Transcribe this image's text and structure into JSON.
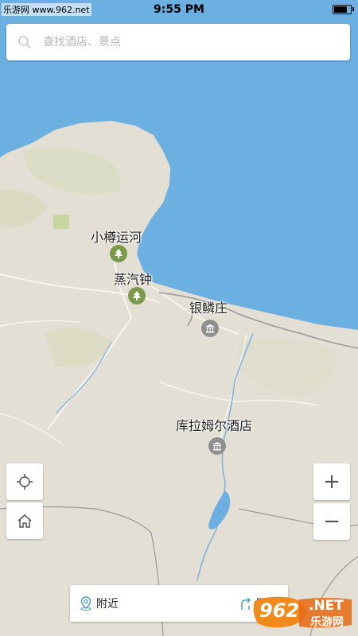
{
  "status_bar": {
    "time": "9:55 PM",
    "site_watermark": "乐游网 www.962.net",
    "battery_level": 0.85
  },
  "search": {
    "placeholder": "查找酒店、景点",
    "value": ""
  },
  "map": {
    "colors": {
      "water": "#6cb0e2",
      "land": "#e4dfd4",
      "green": "#cdd8ad",
      "poi_park": "#7a9a4a",
      "poi_museum": "#8f8f8f"
    },
    "places": [
      {
        "name": "小樽运河",
        "icon": "tree-icon"
      },
      {
        "name": "蒸汽钟",
        "icon": "tree-icon"
      },
      {
        "name": "银鳞庄",
        "icon": "museum-icon"
      },
      {
        "name": "库拉姆尔酒店",
        "icon": "museum-icon"
      }
    ]
  },
  "controls": {
    "locate": {
      "icon": "crosshair-icon"
    },
    "home": {
      "icon": "home-icon"
    },
    "zoom_in": {
      "label": "+"
    },
    "zoom_out": {
      "label": "−"
    }
  },
  "bottom_bar": {
    "nearby_label": "附近",
    "route_label": "路线"
  },
  "watermark": {
    "number": "962",
    "suffix": ".NET",
    "brand": "乐游网"
  }
}
